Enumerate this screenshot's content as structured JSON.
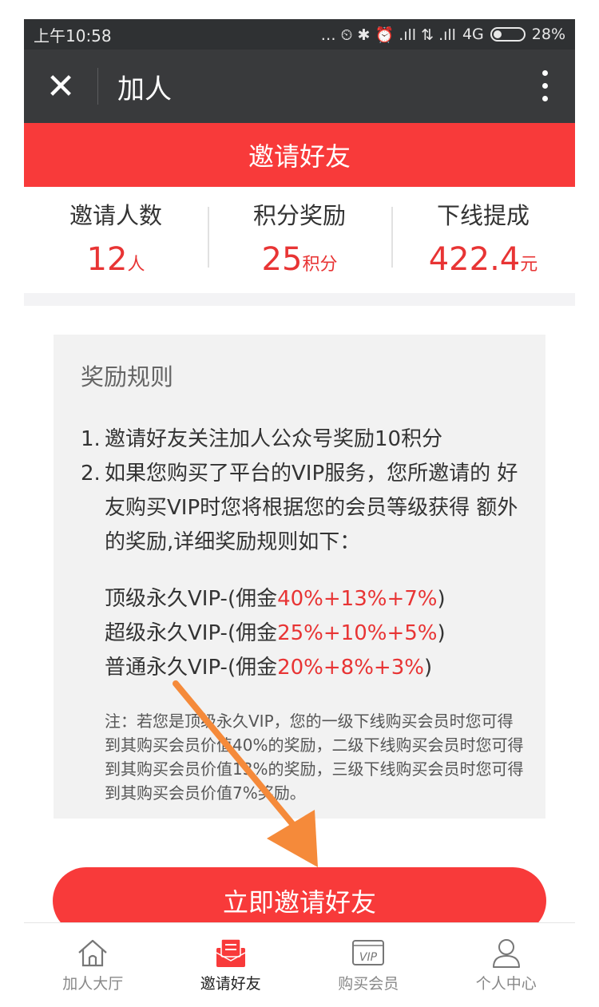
{
  "status_bar": {
    "time": "上午10:58",
    "indicators": "… ⏲ ✱ ⏰ .ıll ⇅ .ıll",
    "network": "4G",
    "battery": "28%",
    "battery_level": 0.28
  },
  "nav": {
    "title": "加人",
    "close_icon": "close-icon",
    "more_icon": "more-vertical-icon"
  },
  "banner": {
    "title": "邀请好友"
  },
  "stats": [
    {
      "label": "邀请人数",
      "value": "12",
      "unit": "人"
    },
    {
      "label": "积分奖励",
      "value": "25",
      "unit": "积分"
    },
    {
      "label": "下线提成",
      "value": "422.4",
      "unit": "元"
    }
  ],
  "rules": {
    "title": "奖励规则",
    "items": [
      {
        "num": "1.",
        "text": "邀请好友关注加人公众号奖励10积分"
      },
      {
        "num": "2.",
        "text": "如果您购买了平台的VIP服务，您所邀请的 好友购买VIP时您将根据您的会员等级获得 额外的奖励,详细奖励规则如下："
      }
    ],
    "tiers": [
      {
        "prefix": "顶级永久VIP-(佣金",
        "rate": "40%+13%+7%",
        "suffix": ")"
      },
      {
        "prefix": "超级永久VIP-(佣金",
        "rate": "25%+10%+5%",
        "suffix": ")"
      },
      {
        "prefix": "普通永久VIP-(佣金",
        "rate": "20%+8%+3%",
        "suffix": ")"
      }
    ],
    "note": "注：若您是顶级永久VIP，您的一级下线购买会员时您可得到其购买会员价值40%的奖励，二级下线购买会员时您可得到其购买会员价值13%的奖励，三级下线购买会员时您可得到其购买会员价值7%奖励。"
  },
  "cta": {
    "label": "立即邀请好友"
  },
  "tabs": [
    {
      "label": "加人大厅",
      "icon": "home-icon",
      "active": false
    },
    {
      "label": "邀请好友",
      "icon": "invite-envelope-icon",
      "active": true
    },
    {
      "label": "购买会员",
      "icon": "vip-icon",
      "active": false
    },
    {
      "label": "个人中心",
      "icon": "user-icon",
      "active": false
    }
  ],
  "colors": {
    "accent": "#f83a3a",
    "nav_bg": "#393a3c",
    "arrow": "#f58a3a"
  }
}
